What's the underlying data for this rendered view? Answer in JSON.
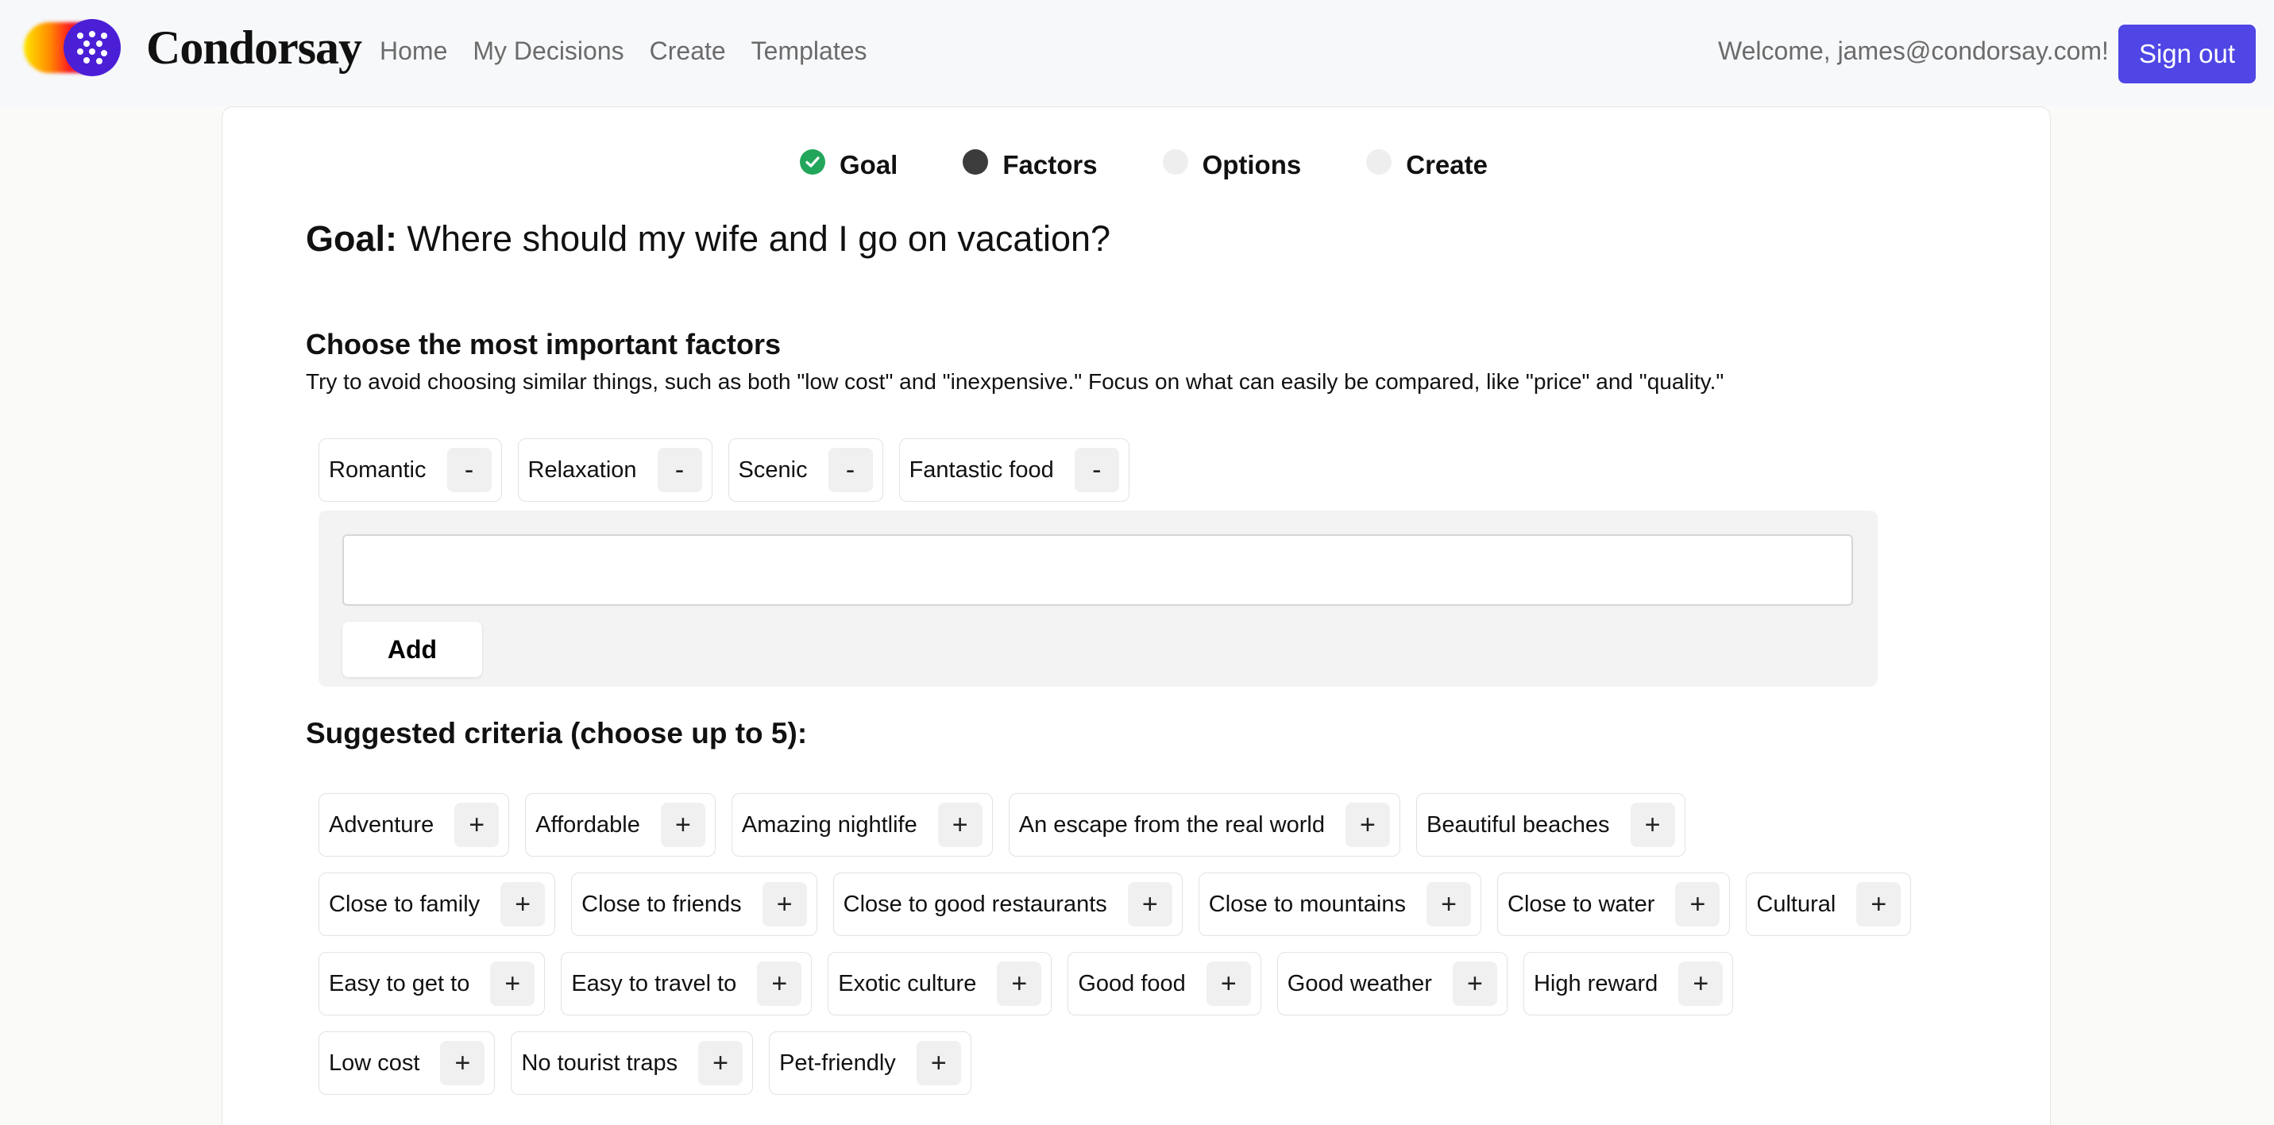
{
  "brand": {
    "name": "Condorsay",
    "colors": {
      "accent": "#4f46e5",
      "logo": "#4a1fd6",
      "success": "#22a65b"
    }
  },
  "nav": {
    "items": [
      "Home",
      "My Decisions",
      "Create",
      "Templates"
    ]
  },
  "header": {
    "welcome": "Welcome, james@condorsay.com!",
    "signout": "Sign out"
  },
  "steps": [
    {
      "label": "Goal",
      "state": "done"
    },
    {
      "label": "Factors",
      "state": "current"
    },
    {
      "label": "Options",
      "state": "pending"
    },
    {
      "label": "Create",
      "state": "pending"
    }
  ],
  "goal": {
    "prefix": "Goal:",
    "text": "Where should my wife and I go on vacation?"
  },
  "factors": {
    "title": "Choose the most important factors",
    "hint": "Try to avoid choosing similar things, such as both \"low cost\" and \"inexpensive.\" Focus on what can easily be compared, like \"price\" and \"quality.\"",
    "selected": [
      "Romantic",
      "Relaxation",
      "Scenic",
      "Fantastic food"
    ],
    "remove_symbol": "-",
    "input_value": "",
    "input_placeholder": "",
    "add_label": "Add"
  },
  "suggested": {
    "title": "Suggested criteria (choose up to 5):",
    "add_symbol": "+",
    "rows": [
      [
        "Adventure",
        "Affordable",
        "Amazing nightlife",
        "An escape from the real world",
        "Beautiful beaches"
      ],
      [
        "Close to family",
        "Close to friends",
        "Close to good restaurants",
        "Close to mountains",
        "Close to water",
        "Cultural"
      ],
      [
        "Easy to get to",
        "Easy to travel to",
        "Exotic culture",
        "Good food",
        "Good weather",
        "High reward"
      ],
      [
        "Low cost",
        "No tourist traps",
        "Pet-friendly"
      ]
    ]
  }
}
